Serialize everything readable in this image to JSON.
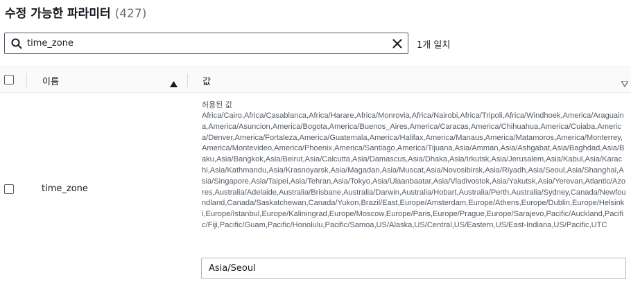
{
  "header": {
    "title": "수정 가능한 파라미터",
    "count": "(427)"
  },
  "search": {
    "value": "time_zone",
    "placeholder": ""
  },
  "match_count": "1개 일치",
  "table": {
    "columns": {
      "name": "이름",
      "value": "값"
    },
    "rows": [
      {
        "name": "time_zone",
        "allowed_label": "허용된 값",
        "allowed_values": "Africa/Cairo,Africa/Casablanca,Africa/Harare,Africa/Monrovia,Africa/Nairobi,Africa/Tripoli,Africa/Windhoek,America/Araguaina,America/Asuncion,America/Bogota,America/Buenos_Aires,America/Caracas,America/Chihuahua,America/Cuiaba,America/Denver,America/Fortaleza,America/Guatemala,America/Halifax,America/Manaus,America/Matamoros,America/Monterrey,America/Montevideo,America/Phoenix,America/Santiago,America/Tijuana,Asia/Amman,Asia/Ashgabat,Asia/Baghdad,Asia/Baku,Asia/Bangkok,Asia/Beirut,Asia/Calcutta,Asia/Damascus,Asia/Dhaka,Asia/Irkutsk,Asia/Jerusalem,Asia/Kabul,Asia/Karachi,Asia/Kathmandu,Asia/Krasnoyarsk,Asia/Magadan,Asia/Muscat,Asia/Novosibirsk,Asia/Riyadh,Asia/Seoul,Asia/Shanghai,Asia/Singapore,Asia/Taipei,Asia/Tehran,Asia/Tokyo,Asia/Ulaanbaatar,Asia/Vladivostok,Asia/Yakutsk,Asia/Yerevan,Atlantic/Azores,Australia/Adelaide,Australia/Brisbane,Australia/Darwin,Australia/Hobart,Australia/Perth,Australia/Sydney,Canada/Newfoundland,Canada/Saskatchewan,Canada/Yukon,Brazil/East,Europe/Amsterdam,Europe/Athens,Europe/Dublin,Europe/Helsinki,Europe/Istanbul,Europe/Kaliningrad,Europe/Moscow,Europe/Paris,Europe/Prague,Europe/Sarajevo,Pacific/Auckland,Pacific/Fiji,Pacific/Guam,Pacific/Honolulu,Pacific/Samoa,US/Alaska,US/Central,US/Eastern,US/East-Indiana,US/Pacific,UTC",
        "current_value": "Asia/Seoul"
      }
    ]
  },
  "icons": {
    "search": "search-icon",
    "clear": "close-icon",
    "sort_ascending": "caret-up-icon",
    "sort_descending": "caret-down-icon"
  }
}
